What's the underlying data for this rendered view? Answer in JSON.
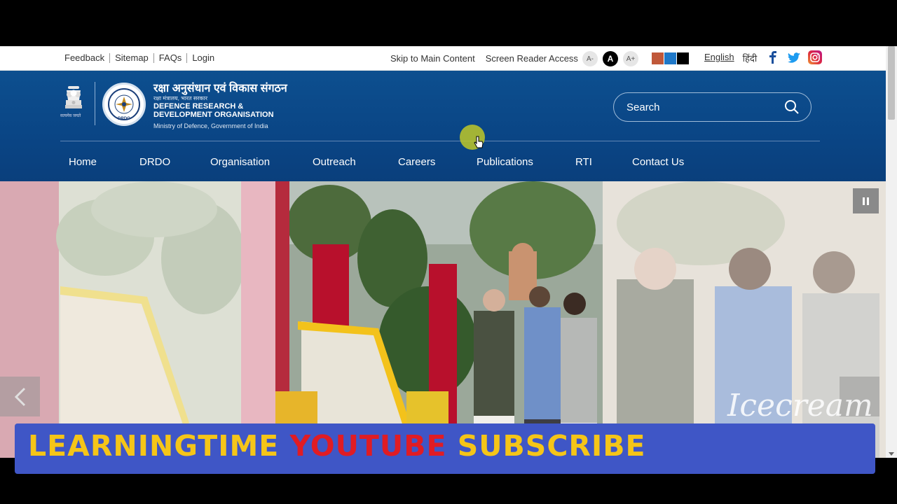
{
  "utility": {
    "left_links": [
      "Feedback",
      "Sitemap",
      "FAQs",
      "Login"
    ],
    "skip_link": "Skip to Main Content",
    "screen_reader": "Screen Reader Access",
    "font_buttons": [
      "A-",
      "A",
      "A+"
    ],
    "theme_colors": [
      "#c0583a",
      "#1f78c8",
      "#000000"
    ],
    "lang_english": "English",
    "lang_hindi": "हिंदी"
  },
  "header": {
    "hindi_name": "रक्षा अनुसंधान एवं विकास संगठन",
    "hindi_sub": "रक्षा मंत्रालय, भारत सरकार",
    "english_name_1": "DEFENCE RESEARCH &",
    "english_name_2": "DEVELOPMENT ORGANISATION",
    "ministry": "Ministry of Defence, Government of India",
    "emblem_caption": "सत्यमेव जयते",
    "logo_text": "DRDO",
    "search_placeholder": "Search"
  },
  "nav": {
    "items": [
      "Home",
      "DRDO",
      "Organisation",
      "Outreach",
      "Careers",
      "Publications",
      "RTI",
      "Contact Us"
    ]
  },
  "banner": {
    "watermark": "Icecream"
  },
  "strip": {
    "part1": "LEARNINGTIME ",
    "part2": "YOUTUBE ",
    "part3": "SUBSCRIBE"
  }
}
